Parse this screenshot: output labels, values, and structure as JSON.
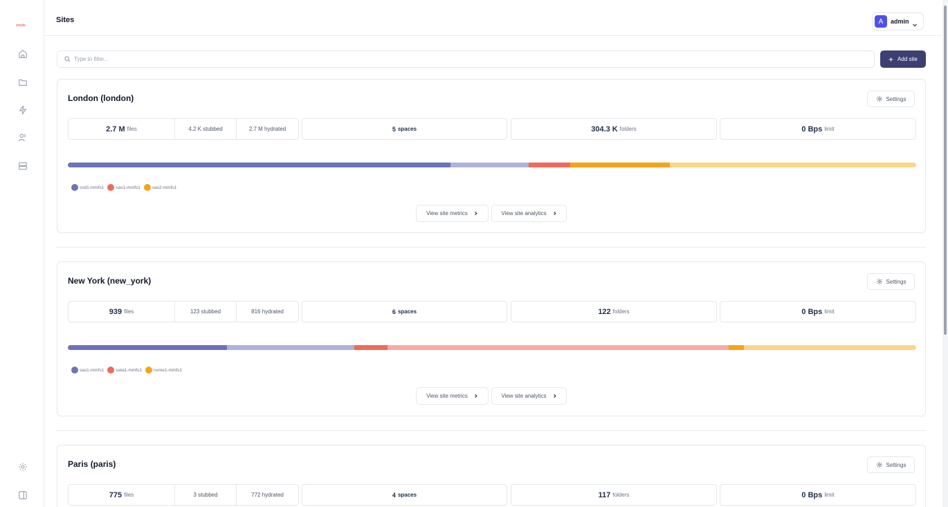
{
  "header": {
    "title": "Sites",
    "user": {
      "initial": "A",
      "name": "admin"
    }
  },
  "sidebar": {
    "logo": "logo-icon",
    "items": [
      {
        "icon": "home-icon"
      },
      {
        "icon": "folder-icon"
      },
      {
        "icon": "activity-icon"
      },
      {
        "icon": "users-icon"
      },
      {
        "icon": "server-icon"
      }
    ],
    "bottom": [
      {
        "icon": "gear-icon"
      },
      {
        "icon": "sidebar-toggle-icon"
      }
    ]
  },
  "toolbar": {
    "filter_placeholder": "Type to filter...",
    "add_site_label": "Add site"
  },
  "colors": {
    "primary": "#3d3f73",
    "accent": "#4f52e5",
    "purple": "#6e72b8",
    "purple_light": "#aeb3db",
    "red": "#ef6a5a",
    "red_light": "#f8aba2",
    "orange": "#f5a318",
    "orange_light": "#fcd58b"
  },
  "sites": [
    {
      "title": "London (london)",
      "settings_label": "Settings",
      "files_value": "2.7 M",
      "files_unit": "files",
      "stubbed": "4.2 K stubbed",
      "hydrated": "2.7 M hydrated",
      "spaces_value": "5",
      "spaces_unit": "spaces",
      "folders_value": "304.3 K",
      "folders_unit": "folders",
      "limit_value": "0 Bps",
      "limit_unit": "limit",
      "usage": [
        {
          "color": "#6e72b8",
          "fraction": 0.451
        },
        {
          "color": "#aeb3db",
          "fraction": 0.092
        },
        {
          "color": "#ef6a5a",
          "fraction": 0.049
        },
        {
          "color": "#f5a318",
          "fraction": 0.118
        },
        {
          "color": "#fcd58b",
          "fraction": 0.29
        }
      ],
      "legend": [
        {
          "label": "ssd1-mmfs1",
          "color": "#6e72b8"
        },
        {
          "label": "sas1-mmfs1",
          "color": "#ef6a5a"
        },
        {
          "label": "sas2-mmfs1",
          "color": "#f5a318"
        }
      ],
      "metrics_label": "View site metrics",
      "analytics_label": "View site analytics"
    },
    {
      "title": "New York (new_york)",
      "settings_label": "Settings",
      "files_value": "939",
      "files_unit": "files",
      "stubbed": "123 stubbed",
      "hydrated": "816 hydrated",
      "spaces_value": "6",
      "spaces_unit": "spaces",
      "folders_value": "122",
      "folders_unit": "folders",
      "limit_value": "0 Bps",
      "limit_unit": "limit",
      "usage": [
        {
          "color": "#6e72b8",
          "fraction": 0.188
        },
        {
          "color": "#aeb3db",
          "fraction": 0.15
        },
        {
          "color": "#ef6a5a",
          "fraction": 0.039
        },
        {
          "color": "#f8aba2",
          "fraction": 0.402
        },
        {
          "color": "#f5a318",
          "fraction": 0.018
        },
        {
          "color": "#fcd58b",
          "fraction": 0.203
        }
      ],
      "legend": [
        {
          "label": "sas1-mmfs1",
          "color": "#6e72b8"
        },
        {
          "label": "sata1-mmfs1",
          "color": "#ef6a5a"
        },
        {
          "label": "nvme1-mmfs1",
          "color": "#f5a318"
        }
      ],
      "metrics_label": "View site metrics",
      "analytics_label": "View site analytics"
    },
    {
      "title": "Paris (paris)",
      "settings_label": "Settings",
      "files_value": "775",
      "files_unit": "files",
      "stubbed": "3 stubbed",
      "hydrated": "772 hydrated",
      "spaces_value": "4",
      "spaces_unit": "spaces",
      "folders_value": "117",
      "folders_unit": "folders",
      "limit_value": "0 Bps",
      "limit_unit": "limit",
      "usage": [],
      "legend": [],
      "metrics_label": "View site metrics",
      "analytics_label": "View site analytics"
    }
  ]
}
